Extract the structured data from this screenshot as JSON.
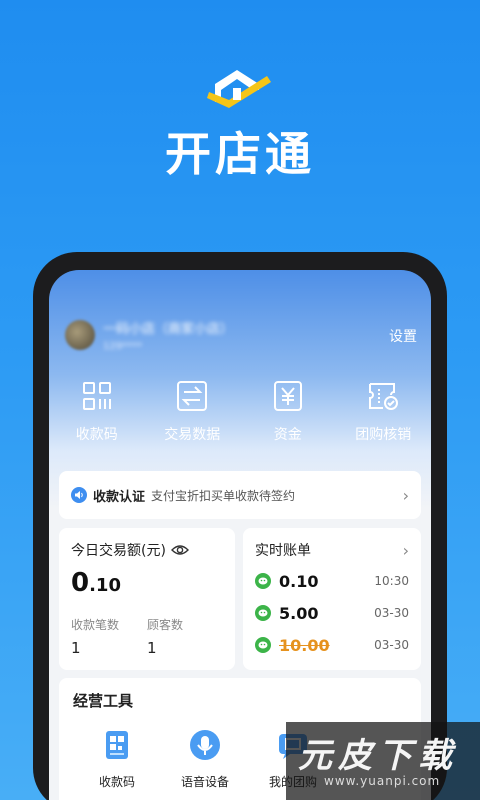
{
  "app": {
    "title": "开店通"
  },
  "header": {
    "shop_name": "一码小店（商家小店）",
    "shop_sub": "129****",
    "settings_label": "设置"
  },
  "quick_actions": [
    {
      "label": "收款码",
      "icon": "qr-code-icon"
    },
    {
      "label": "交易数据",
      "icon": "exchange-icon"
    },
    {
      "label": "资金",
      "icon": "yen-icon"
    },
    {
      "label": "团购核销",
      "icon": "coupon-verify-icon"
    }
  ],
  "auth_notice": {
    "title": "收款认证",
    "desc": "支付宝折扣买单收款待签约"
  },
  "today": {
    "title": "今日交易额(元)",
    "amount_int": "0",
    "amount_dec": ".10",
    "count_label": "收款笔数",
    "count_value": "1",
    "customers_label": "顾客数",
    "customers_value": "1"
  },
  "bills": {
    "title": "实时账单",
    "items": [
      {
        "amount": "0.10",
        "time": "10:30",
        "refunded": false
      },
      {
        "amount": "5.00",
        "time": "03-30",
        "refunded": false
      },
      {
        "amount": "10.00",
        "time": "03-30",
        "refunded": true
      }
    ]
  },
  "tools": {
    "title": "经营工具",
    "items": [
      {
        "label": "收款码",
        "icon": "qr-code-icon"
      },
      {
        "label": "语音设备",
        "icon": "microphone-icon"
      },
      {
        "label": "我的团购",
        "icon": "group-buy-icon"
      }
    ]
  },
  "watermark": {
    "text": "元皮下载",
    "url": "www.yuanpi.com"
  },
  "colors": {
    "brand_blue": "#1f8df0",
    "bill_green": "#3cb449",
    "refund_orange": "#e6921e"
  }
}
